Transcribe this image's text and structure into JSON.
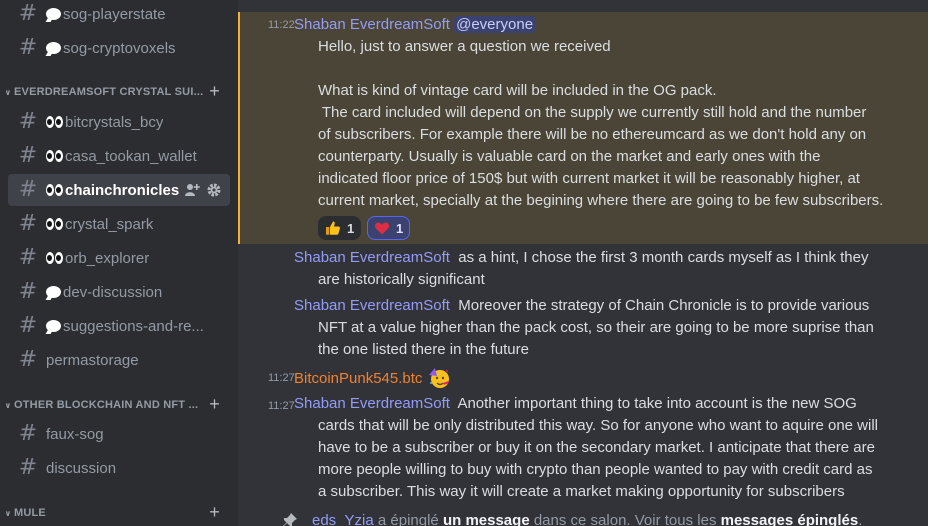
{
  "sidebar": {
    "channels_top": [
      {
        "label": "sog-playerstate",
        "emoji": "speech-balloon"
      },
      {
        "label": "sog-cryptovoxels",
        "emoji": "speech-balloon"
      }
    ],
    "category_crystal": "EVERDREAMSOFT CRYSTAL SUI...",
    "channels_crystal": [
      {
        "label": "bitcrystals_bcy",
        "emoji": "eyes"
      },
      {
        "label": "casa_tookan_wallet",
        "emoji": "eyes"
      },
      {
        "label": "chainchronicles",
        "emoji": "eyes",
        "selected": true
      },
      {
        "label": "crystal_spark",
        "emoji": "eyes"
      },
      {
        "label": "orb_explorer",
        "emoji": "eyes"
      },
      {
        "label": "dev-discussion",
        "emoji": "speech-balloon"
      },
      {
        "label": "suggestions-and-re...",
        "emoji": "speech-balloon"
      },
      {
        "label": "permastorage",
        "emoji": ""
      }
    ],
    "category_other": "OTHER BLOCKCHAIN AND NFT ...",
    "channels_other": [
      {
        "label": "faux-sog"
      },
      {
        "label": "discussion"
      }
    ],
    "category_mule": "MULE"
  },
  "messages": {
    "m1": {
      "time": "11:22",
      "author": "Shaban EverdreamSoft",
      "mention": "@everyone",
      "lines": [
        "Hello, just to answer a question we received",
        "",
        "What is kind of vintage card will be included in the OG pack.",
        " The card included will depend on the supply we currently still hold and the number",
        "of subscribers. For example there will be no ethereumcard as we don't hold any on",
        "counterparty. Usually is valuable card on the market and early ones with the",
        "indicated floor price of 150$ but with current market it will be reasonably higher, at",
        "current market, specially at the begining where there are going to be few subscribers."
      ],
      "reactions": [
        {
          "emoji": "thumbs-up",
          "count": "1"
        },
        {
          "emoji": "red-heart",
          "count": "1"
        }
      ]
    },
    "m2": {
      "author": "Shaban EverdreamSoft",
      "lines": [
        "as a hint, I chose the first 3 month cards myself as I think they",
        "are historically significant"
      ]
    },
    "m3": {
      "author": "Shaban EverdreamSoft",
      "lines": [
        "Moreover the strategy of Chain Chronicle is to provide various",
        "NFT at a value higher than the pack cost, so their are going to be more suprise than",
        "the one listed there in the future"
      ]
    },
    "m4": {
      "time": "11:27",
      "author": "BitcoinPunk545.btc",
      "emoji": "partying-face"
    },
    "m5": {
      "time": "11:27",
      "author": "Shaban EverdreamSoft",
      "lines": [
        "Another important thing to take into account is the new SOG",
        "cards that will be only distributed this way. So for anyone who want to aquire one will",
        "have to be a subscriber or buy it on the secondary market. I anticipate that there are",
        "more people willing to buy with crypto than people wanted to pay with credit card as",
        "a subscriber. This way it will create a market making opportunity for subscribers"
      ]
    },
    "pin": {
      "user": "eds_Yzia",
      "text1": "a épinglé",
      "link1": "un message",
      "text2": "dans ce salon. Voir tous les",
      "link2": "messages épinglés",
      "end": "."
    }
  },
  "colors": {
    "sidebar_bg": "#2b2d31",
    "chat_bg": "#313338",
    "highlight_bg": "#4a4536",
    "highlight_border": "#f0b232",
    "author_blue": "#949cf7",
    "author_orange": "#f0812e"
  }
}
